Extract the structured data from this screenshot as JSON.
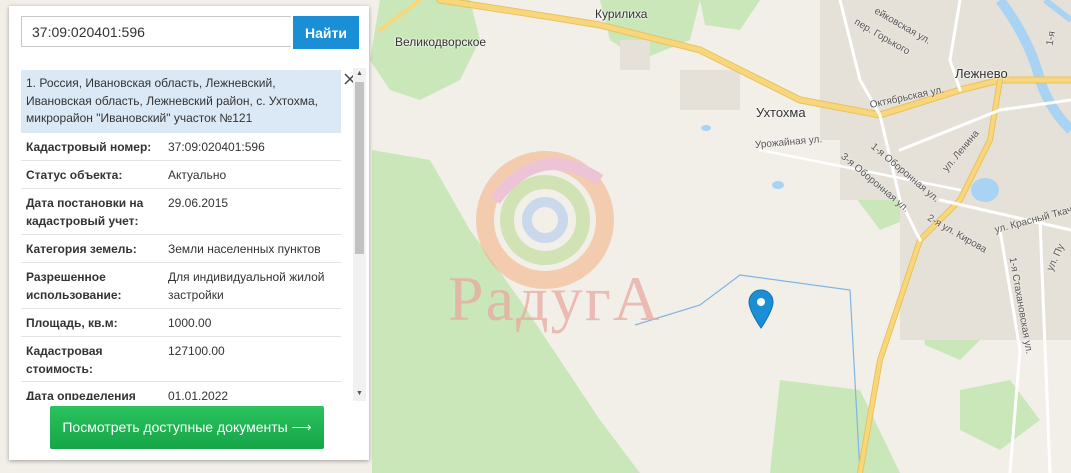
{
  "search": {
    "value": "37:09:020401:596",
    "button_label": "Найти"
  },
  "result": {
    "title": "1. Россия, Ивановская область, Лежневский, Ивановская область, Лежневский район, с. Ухтохма, микрорайон \"Ивановский\" участок №121",
    "rows": [
      {
        "key": "Кадастровый номер:",
        "value": "37:09:020401:596"
      },
      {
        "key": "Статус объекта:",
        "value": "Актуально"
      },
      {
        "key": "Дата постановки на кадастровый учет:",
        "value": "29.06.2015"
      },
      {
        "key": "Категория земель:",
        "value": "Земли населенных пунктов"
      },
      {
        "key": "Разрешенное использование:",
        "value": "Для индивидуальной жилой застройки"
      },
      {
        "key": "Площадь, кв.м:",
        "value": "1000.00"
      },
      {
        "key": "Кадастровая стоимость:",
        "value": "127100.00"
      },
      {
        "key": "Дата определения",
        "value": "01.01.2022"
      }
    ]
  },
  "docs_button_label": "Посмотреть доступные документы ⟶",
  "map": {
    "places": {
      "kurilikha": "Курилиха",
      "velikodvorskoe": "Великодворское",
      "ukhtokhma": "Ухтохма",
      "lezhnevo": "Лежнево"
    },
    "streets": {
      "gorkogo": "пер. Горького",
      "yeikovskaya": "ейковская ул.",
      "oktyabrskaya": "Октябрьская ул.",
      "urozhainaya": "Урожайная ул.",
      "oboronnaya1": "1-я Оборонная ул.",
      "oboronnaya3": "3-я Оборонная ул.",
      "lenina": "ул. Ленина",
      "kirova": "2-я ул. Кирова",
      "krasny_tkach": "ул. Красный Ткач",
      "stakhanovskaya": "1-я Стахановская ул.",
      "pu": "ул. Пу",
      "first_ya": "1-я"
    },
    "watermark": "РадугА",
    "colors": {
      "forest": "#c9e7b9",
      "road": "#f8d77c",
      "river": "#a9d3f2",
      "marker": "#1a8fd6"
    }
  },
  "icons": {
    "close": "close-icon",
    "scroll_up": "▲",
    "scroll_down": "▼"
  }
}
